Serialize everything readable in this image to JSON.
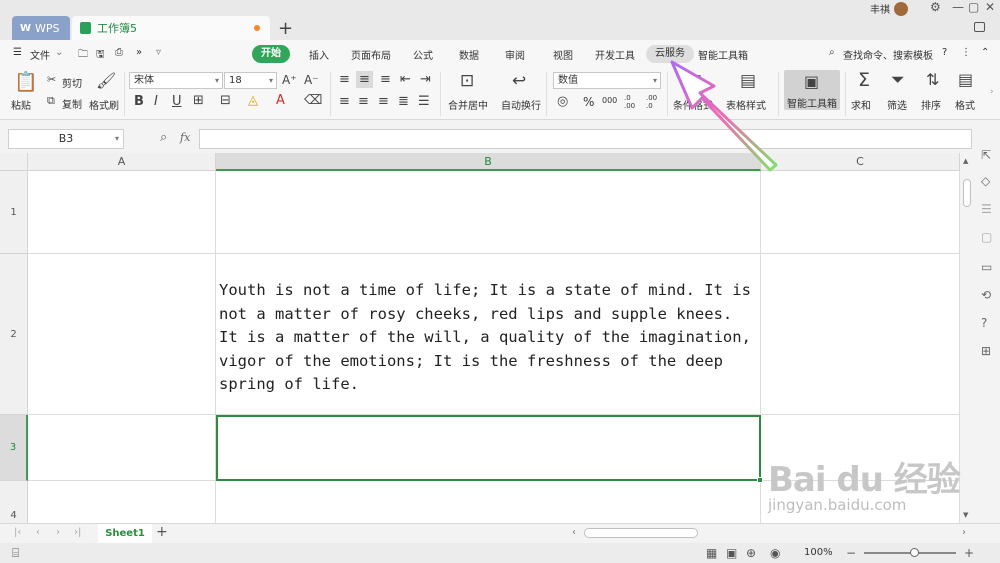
{
  "titlebar": {
    "tabs": [
      {
        "label": "WPS"
      },
      {
        "label": "工作簿5"
      }
    ],
    "user_name": "丰祺",
    "window_controls": [
      "⚙",
      "—",
      "▢",
      "✕"
    ]
  },
  "menu": {
    "file": "文件",
    "items": [
      "开始",
      "插入",
      "页面布局",
      "公式",
      "数据",
      "审阅",
      "视图",
      "开发工具",
      "云服务",
      "智能工具箱"
    ],
    "search": "查找命令、搜索模板",
    "more": "?"
  },
  "toolbar": {
    "paste": "粘贴",
    "cut": "剪切",
    "copy": "复制",
    "format_painter": "格式刷",
    "font_name": "宋体",
    "font_size": "18",
    "merge_center": "合并居中",
    "wrap_text": "自动换行",
    "number_format": "数值",
    "conditional_format": "条件格式",
    "table_style": "表格样式",
    "smart_toolbox": "智能工具箱",
    "sum": "求和",
    "filter": "筛选",
    "sort": "排序",
    "format": "格式",
    "percent": "%",
    "comma": "000",
    "inc_decimal": ".0 .00",
    "dec_decimal": ".00 .0"
  },
  "formula_bar": {
    "name_box": "B3",
    "fx": "fx",
    "content": ""
  },
  "grid": {
    "columns": [
      "A",
      "B",
      "C"
    ],
    "active_column": "B",
    "rows": [
      "1",
      "2",
      "3",
      "4"
    ],
    "active_row": "3",
    "cell_b2_text": "Youth is not a time of life; It is a state of mind. It is\nnot a matter of rosy cheeks, red lips and supple knees.\nIt is a matter of the will, a quality of the imagination,\nvigor of the emotions; It is the freshness of the deep\nspring of life."
  },
  "sheets": {
    "tabs": [
      "Sheet1"
    ],
    "add": "+"
  },
  "status": {
    "zoom": "100%",
    "zoom_out": "−",
    "zoom_in": "+",
    "slider_level": 0.55
  },
  "watermark": {
    "brand": "Bai du 经验",
    "url": "jingyan.baidu.com"
  },
  "colors": {
    "accent": "#2fa659",
    "selection": "#2d8c3f",
    "arrow_start": "#7ee36b",
    "arrow_end": "#b06bf0"
  }
}
